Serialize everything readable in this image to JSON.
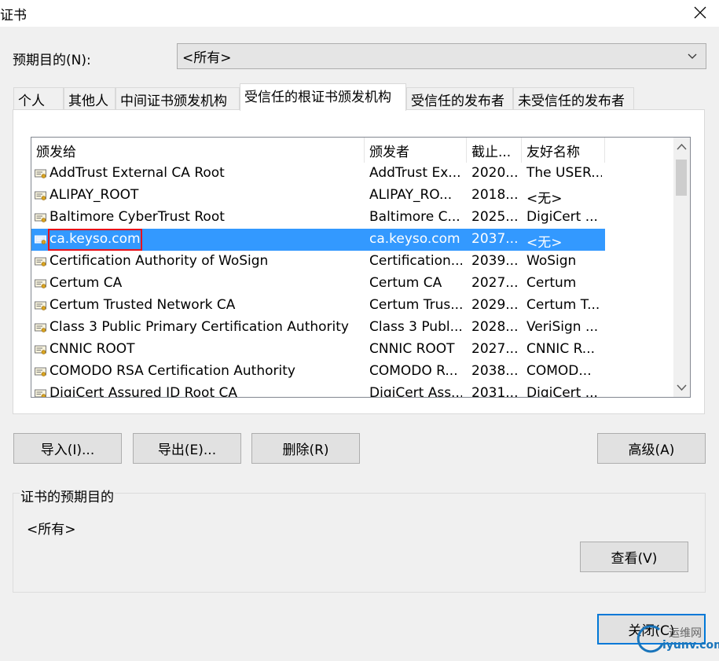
{
  "window": {
    "title": "证书"
  },
  "purpose": {
    "label": "预期目的(N):",
    "value": "<所有>"
  },
  "tabs": [
    {
      "label": "个人",
      "active": false
    },
    {
      "label": "其他人",
      "active": false
    },
    {
      "label": "中间证书颁发机构",
      "active": false
    },
    {
      "label": "受信任的根证书颁发机构",
      "active": true
    },
    {
      "label": "受信任的发布者",
      "active": false
    },
    {
      "label": "未受信任的发布者",
      "active": false
    }
  ],
  "list": {
    "columns": [
      "颁发给",
      "颁发者",
      "截止...",
      "友好名称"
    ],
    "rows": [
      {
        "issued_to": "AddTrust External CA Root",
        "issued_by": "AddTrust Ex...",
        "expires": "2020...",
        "friendly": "The USER..."
      },
      {
        "issued_to": "ALIPAY_ROOT",
        "issued_by": "ALIPAY_RO...",
        "expires": "2018...",
        "friendly": "<无>"
      },
      {
        "issued_to": "Baltimore CyberTrust Root",
        "issued_by": "Baltimore C...",
        "expires": "2025...",
        "friendly": "DigiCert ..."
      },
      {
        "issued_to": "ca.keyso.com",
        "issued_by": "ca.keyso.com",
        "expires": "2037...",
        "friendly": "<无>",
        "selected": true
      },
      {
        "issued_to": "Certification Authority of WoSign",
        "issued_by": "Certification...",
        "expires": "2039...",
        "friendly": "WoSign"
      },
      {
        "issued_to": "Certum CA",
        "issued_by": "Certum CA",
        "expires": "2027...",
        "friendly": "Certum"
      },
      {
        "issued_to": "Certum Trusted Network CA",
        "issued_by": "Certum Trus...",
        "expires": "2029...",
        "friendly": "Certum T..."
      },
      {
        "issued_to": "Class 3 Public Primary Certification Authority",
        "issued_by": "Class 3 Publ...",
        "expires": "2028...",
        "friendly": "VeriSign ..."
      },
      {
        "issued_to": "CNNIC ROOT",
        "issued_by": "CNNIC ROOT",
        "expires": "2027...",
        "friendly": "CNNIC R..."
      },
      {
        "issued_to": "COMODO RSA Certification Authority",
        "issued_by": "COMODO R...",
        "expires": "2038...",
        "friendly": "COMOD..."
      },
      {
        "issued_to": "DigiCert Assured ID Root CA",
        "issued_by": "DigiCert Ass...",
        "expires": "2031...",
        "friendly": "DigiCert ..."
      }
    ]
  },
  "buttons": {
    "import": "导入(I)...",
    "export": "导出(E)...",
    "remove": "删除(R)",
    "advanced": "高级(A)",
    "view": "查看(V)",
    "close": "关闭(C)"
  },
  "purposes_group": {
    "title": "证书的预期目的",
    "value": "<所有>"
  },
  "watermark": {
    "line1": "运维网",
    "line2": "iyunv.com"
  },
  "colors": {
    "selection": "#3399ff",
    "highlight_box": "#e8121b",
    "default_button_border": "#0078d7"
  }
}
